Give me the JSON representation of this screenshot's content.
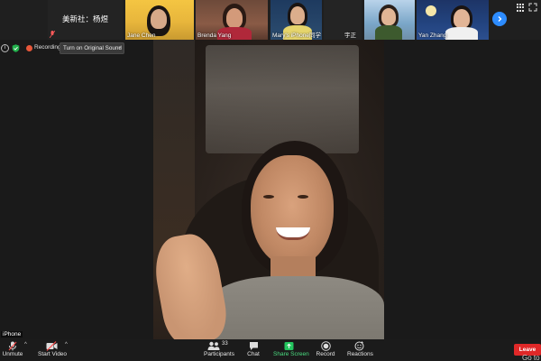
{
  "thumbnails": [
    {
      "name": "美新社：杨煜",
      "muted": true
    },
    {
      "name": "Jane Chen"
    },
    {
      "name": "Brenda Yang"
    },
    {
      "name": "Mary's iPhone同学"
    },
    {
      "name": "宇正"
    },
    {
      "name": ""
    },
    {
      "name": "Yan Zhang"
    }
  ],
  "info_bar": {
    "recording_label": "Recording",
    "sound_button": "Turn on Original Sound"
  },
  "main_video": {
    "participant_label": "iPhone"
  },
  "toolbar": {
    "unmute": "Unmute",
    "start_video": "Start Video",
    "participants_count": "33",
    "participants": "Participants",
    "chat": "Chat",
    "share_screen": "Share Screen",
    "record": "Record",
    "reactions": "Reactions",
    "leave": "Leave",
    "goto": "Go to"
  },
  "colors": {
    "share_green": "#23c55e",
    "leave_red": "#e02828",
    "accent_blue": "#2d8cff",
    "recording_orange": "#e8573a"
  }
}
